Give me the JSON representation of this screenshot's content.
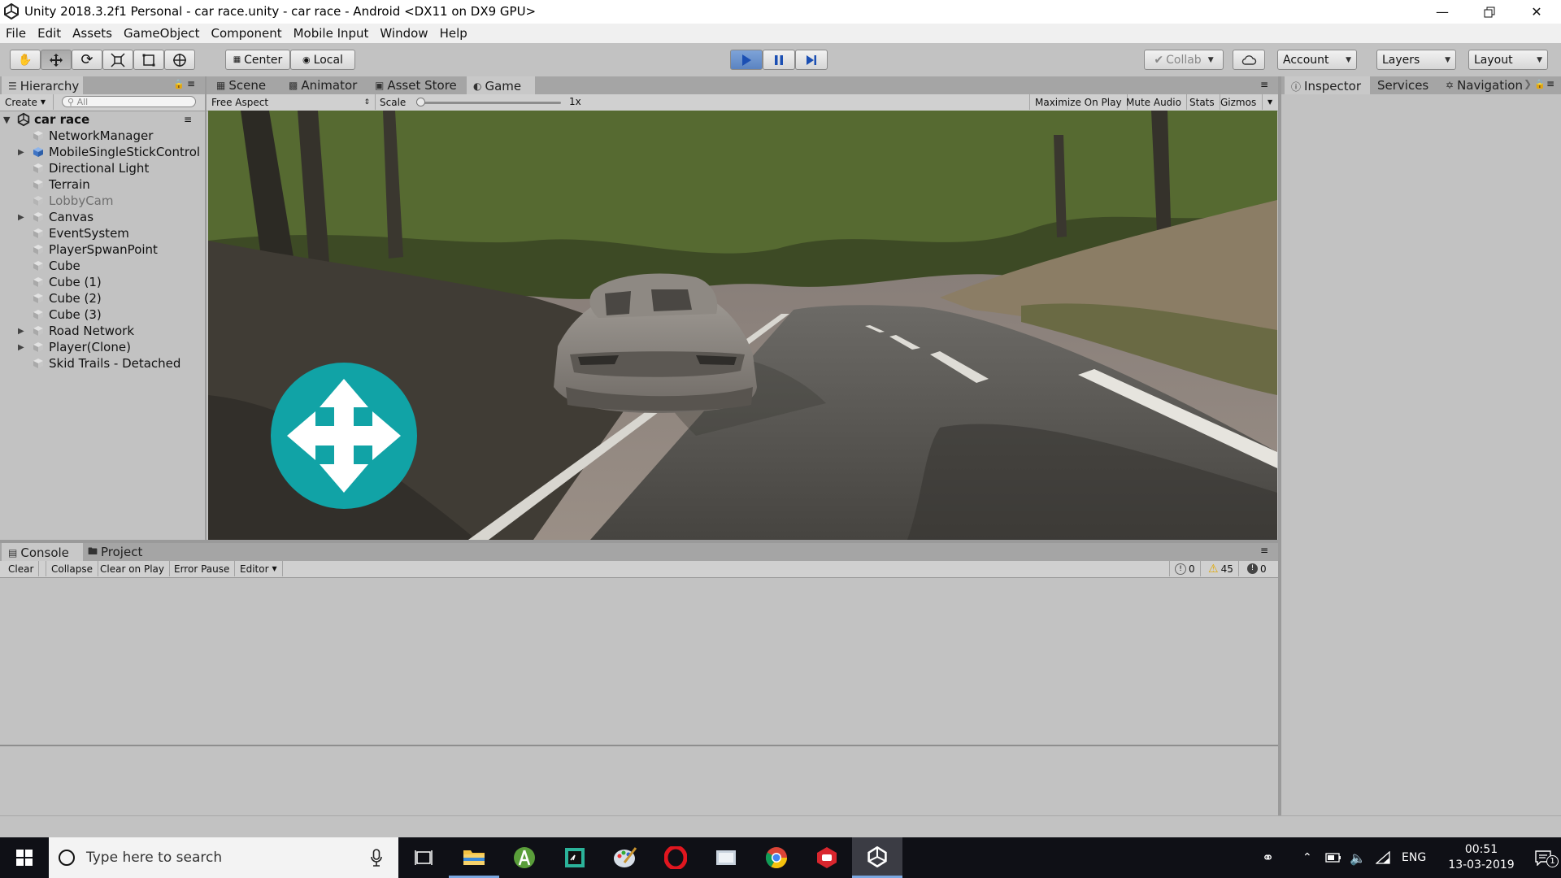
{
  "window": {
    "title": "Unity 2018.3.2f1 Personal - car race.unity - car race - Android <DX11 on DX9 GPU>",
    "controls": [
      "minimize",
      "restore",
      "close"
    ]
  },
  "menu": [
    "File",
    "Edit",
    "Assets",
    "GameObject",
    "Component",
    "Mobile Input",
    "Window",
    "Help"
  ],
  "toolbar": {
    "pivot_label": "Center",
    "space_label": "Local",
    "collab_label": "Collab",
    "account_label": "Account",
    "layers_label": "Layers",
    "layout_label": "Layout",
    "play_active": true
  },
  "hierarchy": {
    "tab_label": "Hierarchy",
    "create_label": "Create",
    "search_placeholder": "All",
    "scene_name": "car race",
    "items": [
      {
        "label": "NetworkManager",
        "expandable": false,
        "dim": false,
        "icon": "cube-icon"
      },
      {
        "label": "MobileSingleStickControl",
        "expandable": true,
        "dim": false,
        "icon": "prefab-icon"
      },
      {
        "label": "Directional Light",
        "expandable": false,
        "dim": false,
        "icon": "cube-icon"
      },
      {
        "label": "Terrain",
        "expandable": false,
        "dim": false,
        "icon": "cube-icon"
      },
      {
        "label": "LobbyCam",
        "expandable": false,
        "dim": true,
        "icon": "cube-icon"
      },
      {
        "label": "Canvas",
        "expandable": true,
        "dim": false,
        "icon": "cube-icon"
      },
      {
        "label": "EventSystem",
        "expandable": false,
        "dim": false,
        "icon": "cube-icon"
      },
      {
        "label": "PlayerSpwanPoint",
        "expandable": false,
        "dim": false,
        "icon": "cube-icon"
      },
      {
        "label": "Cube",
        "expandable": false,
        "dim": false,
        "icon": "cube-icon"
      },
      {
        "label": "Cube (1)",
        "expandable": false,
        "dim": false,
        "icon": "cube-icon"
      },
      {
        "label": "Cube (2)",
        "expandable": false,
        "dim": false,
        "icon": "cube-icon"
      },
      {
        "label": "Cube (3)",
        "expandable": false,
        "dim": false,
        "icon": "cube-icon"
      },
      {
        "label": "Road Network",
        "expandable": true,
        "dim": false,
        "icon": "cube-icon"
      },
      {
        "label": "Player(Clone)",
        "expandable": true,
        "dim": false,
        "icon": "cube-icon"
      },
      {
        "label": "Skid Trails - Detached",
        "expandable": false,
        "dim": false,
        "icon": "cube-icon"
      }
    ]
  },
  "center_tabs": [
    {
      "label": "Scene",
      "icon": "grid-icon",
      "active": false
    },
    {
      "label": "Animator",
      "icon": "animator-icon",
      "active": false
    },
    {
      "label": "Asset Store",
      "icon": "store-icon",
      "active": false
    },
    {
      "label": "Game",
      "icon": "game-icon",
      "active": true
    }
  ],
  "game_bar": {
    "aspect": "Free Aspect",
    "scale_label": "Scale",
    "scale_value": "1x",
    "scale_fraction": 0.0,
    "maximize_label": "Maximize On Play",
    "mute_label": "Mute Audio",
    "stats_label": "Stats",
    "gizmos_label": "Gizmos"
  },
  "right_tabs": [
    {
      "label": "Inspector",
      "icon": "info-icon",
      "active": true
    },
    {
      "label": "Services",
      "icon": "",
      "active": false
    },
    {
      "label": "Navigation",
      "icon": "navigation-icon",
      "active": false
    }
  ],
  "console": {
    "tabs": [
      {
        "label": "Console",
        "icon": "console-icon",
        "active": true
      },
      {
        "label": "Project",
        "icon": "folder-icon",
        "active": false
      }
    ],
    "buttons": [
      "Clear",
      "Collapse",
      "Clear on Play",
      "Error Pause",
      "Editor"
    ],
    "info_count": "0",
    "warning_count": "45",
    "error_count": "0"
  },
  "taskbar": {
    "search_placeholder": "Type here to search",
    "apps": [
      "task-view-icon",
      "file-explorer-icon",
      "android-studio-icon",
      "pycharm-icon",
      "paint-icon",
      "opera-icon",
      "explorer-folder-icon",
      "chrome-icon",
      "app-red-icon",
      "unity-icon"
    ],
    "language": "ENG",
    "time": "00:51",
    "date": "13-03-2019",
    "notification_count": "1"
  },
  "colors": {
    "unity_panel": "#c2c2c2",
    "tab_bar": "#a5a5a5",
    "play_blue": "#5b84c2",
    "joystick_teal": "#11a3a6",
    "taskbar": "#0f1016"
  }
}
